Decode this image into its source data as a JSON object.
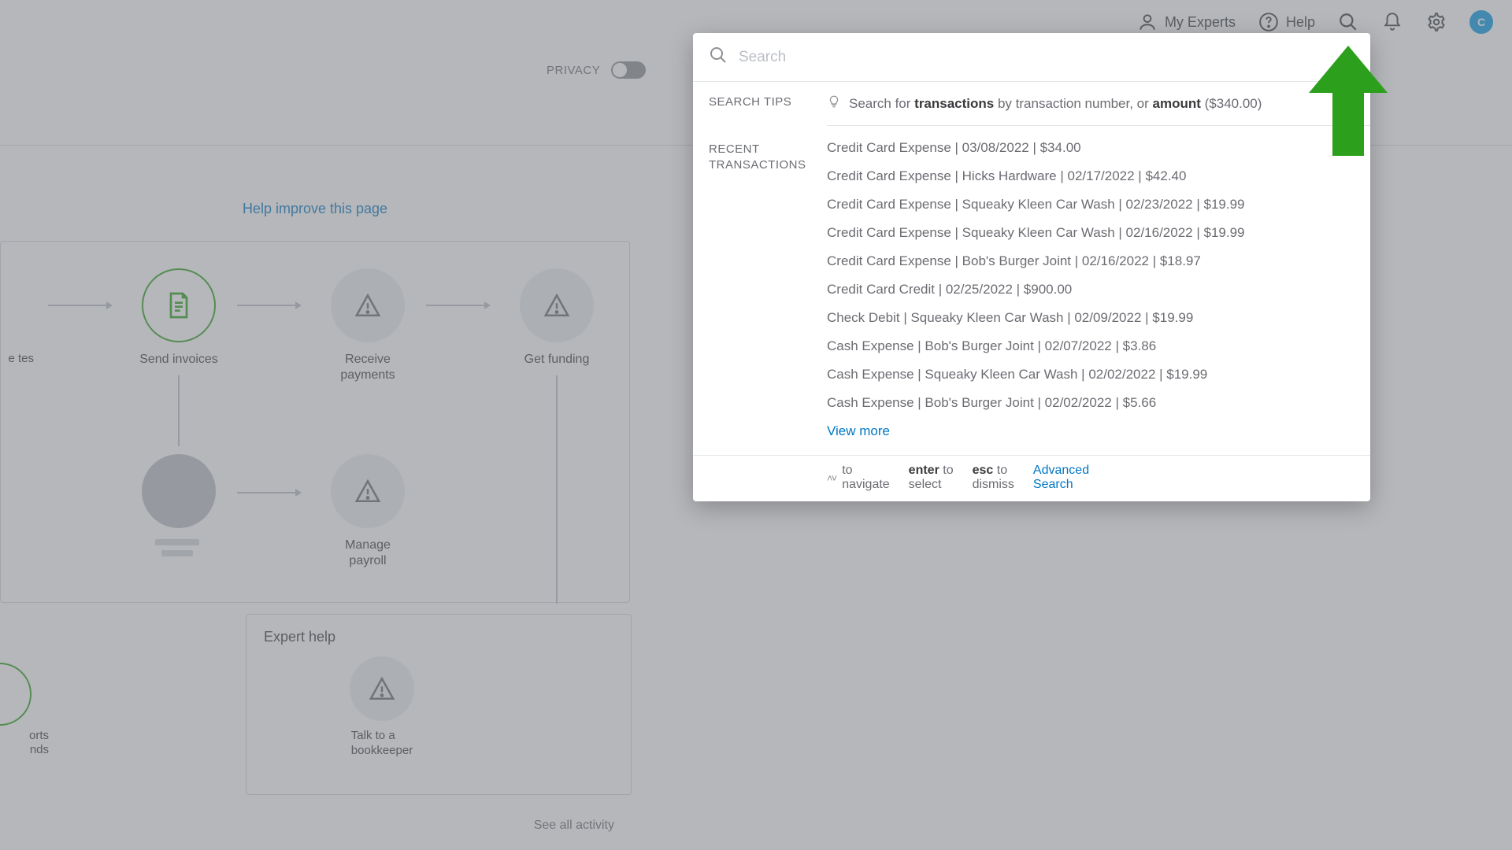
{
  "header": {
    "experts_label": "My Experts",
    "help_label": "Help",
    "avatar_initial": "C"
  },
  "privacy": {
    "label": "PRIVACY"
  },
  "help_improve_label": "Help improve this page",
  "nodes": {
    "edge_top_label": "e\ntes",
    "send_invoices": "Send invoices",
    "receive_payments": "Receive\npayments",
    "get_funding": "Get funding",
    "manage_payroll": "Manage\npayroll",
    "edge_bottom_label": "orts\nnds"
  },
  "expert": {
    "title": "Expert help",
    "talk_label": "Talk to a\nbookkeeper"
  },
  "see_all_label": "See all activity",
  "search": {
    "placeholder": "Search",
    "tips_label": "SEARCH TIPS",
    "tips_prefix": "Search for ",
    "tips_bold1": "transactions",
    "tips_mid": " by transaction number, or ",
    "tips_bold2": "amount",
    "tips_suffix": " ($340.00)",
    "recent_label": "RECENT\nTRANSACTIONS",
    "items": [
      "Credit Card Expense  | 03/08/2022 | $34.00",
      "Credit Card Expense  | Hicks Hardware | 02/17/2022 | $42.40",
      "Credit Card Expense  | Squeaky Kleen Car Wash | 02/23/2022 | $19.99",
      "Credit Card Expense  | Squeaky Kleen Car Wash | 02/16/2022 | $19.99",
      "Credit Card Expense  | Bob's Burger Joint | 02/16/2022 | $18.97",
      "Credit Card Credit  | 02/25/2022 | $900.00",
      "Check Debit  | Squeaky Kleen Car Wash | 02/09/2022 | $19.99",
      "Cash Expense  | Bob's Burger Joint | 02/07/2022 | $3.86",
      "Cash Expense  | Squeaky Kleen Car Wash | 02/02/2022 | $19.99",
      "Cash Expense  | Bob's Burger Joint | 02/02/2022 | $5.66"
    ],
    "view_more": "View more",
    "nav_hint": "to navigate",
    "enter_key": "enter",
    "enter_hint": "to select",
    "esc_key": "esc",
    "esc_hint": "to dismiss",
    "advanced": "Advanced Search"
  }
}
